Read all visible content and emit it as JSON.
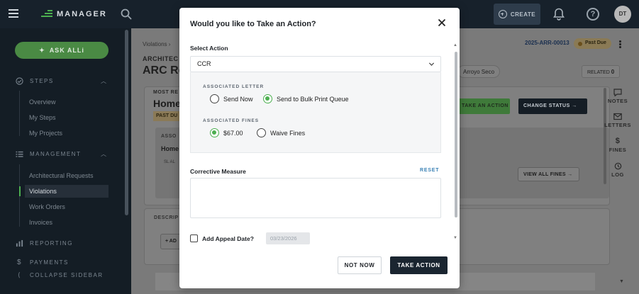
{
  "topbar": {
    "logo_text": "MANAGER",
    "create_label": "CREATE",
    "help_glyph": "?",
    "avatar_initials": "DT",
    "icons": [
      "menu-icon",
      "search-icon",
      "plus-circle-icon",
      "bell-icon",
      "help-icon"
    ]
  },
  "sidebar": {
    "ask_label": "ASK ALLi",
    "sections": {
      "steps": "STEPS",
      "management": "MANAGEMENT",
      "reporting": "REPORTING",
      "payments": "PAYMENTS",
      "collapse": "COLLAPSE SIDEBAR"
    },
    "steps_items": [
      "Overview",
      "My Steps",
      "My Projects"
    ],
    "management_items": [
      "Architectural Requests",
      "Violations",
      "Work Orders",
      "Invoices"
    ],
    "active_item": "Violations",
    "accent_color": "#4caf50"
  },
  "main": {
    "breadcrumb": "Violations  ›",
    "section_label": "ARCHITEC",
    "title": "ARC Re",
    "case_number": "2025-ARR-00013",
    "status_badge": "Past Due",
    "location_chip": "Arroyo Seco",
    "related_label": "RELATED",
    "related_count": "0",
    "most_recent": "MOST RE",
    "home_heading": "Home",
    "past_due_tag": "PAST DU",
    "assoc_label": "ASSO",
    "home_sub": "Home",
    "sl_text": "SL  AL",
    "take_action_label": "TAKE AN ACTION",
    "change_status_label": "CHANGE STATUS",
    "view_fines_label": "VIEW ALL FINES",
    "desc_label": "DESCRIP",
    "add_label": "+ AD"
  },
  "rail": {
    "items": [
      "NOTES",
      "LETTERS",
      "FINES",
      "LOG"
    ]
  },
  "modal": {
    "title": "Would you like to Take an Action?",
    "select_action_label": "Select Action",
    "select_action_value": "CCR",
    "associated_letter_label": "ASSOCIATED LETTER",
    "letter_options": [
      "Send Now",
      "Send to Bulk Print Queue"
    ],
    "letter_selected": "Send to Bulk Print Queue",
    "associated_fines_label": "ASSOCIATED FINES",
    "fine_options": [
      "$67.00",
      "Waive Fines"
    ],
    "fine_selected": "$67.00",
    "corrective_label": "Corrective Measure",
    "reset_label": "RESET",
    "corrective_value": "",
    "appeal_label": "Add Appeal Date?",
    "appeal_checked": false,
    "appeal_date": "03/23/2026",
    "not_now_label": "NOT NOW",
    "take_action_label": "TAKE ACTION",
    "primary_color": "#1a2530",
    "radio_color": "#4caf50"
  }
}
